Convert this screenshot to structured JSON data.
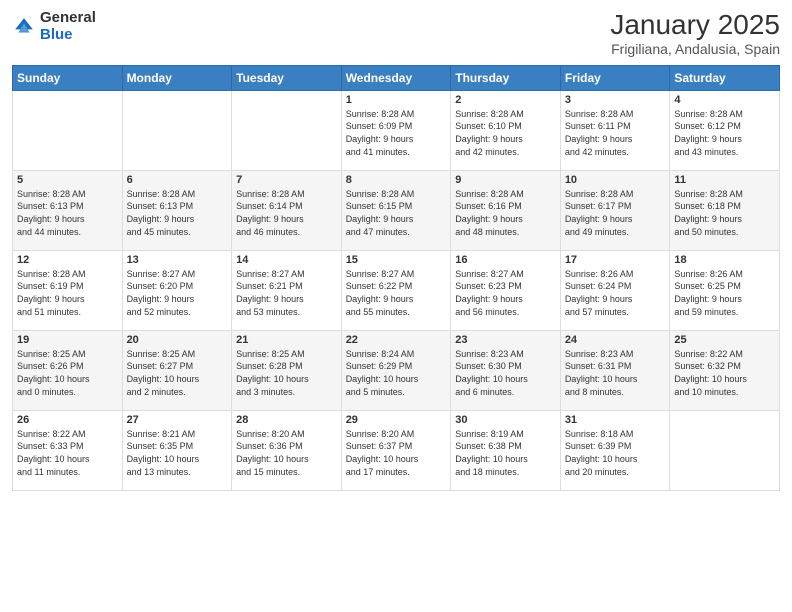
{
  "logo": {
    "general": "General",
    "blue": "Blue"
  },
  "header": {
    "title": "January 2025",
    "subtitle": "Frigiliana, Andalusia, Spain"
  },
  "weekdays": [
    "Sunday",
    "Monday",
    "Tuesday",
    "Wednesday",
    "Thursday",
    "Friday",
    "Saturday"
  ],
  "weeks": [
    [
      {
        "day": "",
        "info": ""
      },
      {
        "day": "",
        "info": ""
      },
      {
        "day": "",
        "info": ""
      },
      {
        "day": "1",
        "info": "Sunrise: 8:28 AM\nSunset: 6:09 PM\nDaylight: 9 hours\nand 41 minutes."
      },
      {
        "day": "2",
        "info": "Sunrise: 8:28 AM\nSunset: 6:10 PM\nDaylight: 9 hours\nand 42 minutes."
      },
      {
        "day": "3",
        "info": "Sunrise: 8:28 AM\nSunset: 6:11 PM\nDaylight: 9 hours\nand 42 minutes."
      },
      {
        "day": "4",
        "info": "Sunrise: 8:28 AM\nSunset: 6:12 PM\nDaylight: 9 hours\nand 43 minutes."
      }
    ],
    [
      {
        "day": "5",
        "info": "Sunrise: 8:28 AM\nSunset: 6:13 PM\nDaylight: 9 hours\nand 44 minutes."
      },
      {
        "day": "6",
        "info": "Sunrise: 8:28 AM\nSunset: 6:13 PM\nDaylight: 9 hours\nand 45 minutes."
      },
      {
        "day": "7",
        "info": "Sunrise: 8:28 AM\nSunset: 6:14 PM\nDaylight: 9 hours\nand 46 minutes."
      },
      {
        "day": "8",
        "info": "Sunrise: 8:28 AM\nSunset: 6:15 PM\nDaylight: 9 hours\nand 47 minutes."
      },
      {
        "day": "9",
        "info": "Sunrise: 8:28 AM\nSunset: 6:16 PM\nDaylight: 9 hours\nand 48 minutes."
      },
      {
        "day": "10",
        "info": "Sunrise: 8:28 AM\nSunset: 6:17 PM\nDaylight: 9 hours\nand 49 minutes."
      },
      {
        "day": "11",
        "info": "Sunrise: 8:28 AM\nSunset: 6:18 PM\nDaylight: 9 hours\nand 50 minutes."
      }
    ],
    [
      {
        "day": "12",
        "info": "Sunrise: 8:28 AM\nSunset: 6:19 PM\nDaylight: 9 hours\nand 51 minutes."
      },
      {
        "day": "13",
        "info": "Sunrise: 8:27 AM\nSunset: 6:20 PM\nDaylight: 9 hours\nand 52 minutes."
      },
      {
        "day": "14",
        "info": "Sunrise: 8:27 AM\nSunset: 6:21 PM\nDaylight: 9 hours\nand 53 minutes."
      },
      {
        "day": "15",
        "info": "Sunrise: 8:27 AM\nSunset: 6:22 PM\nDaylight: 9 hours\nand 55 minutes."
      },
      {
        "day": "16",
        "info": "Sunrise: 8:27 AM\nSunset: 6:23 PM\nDaylight: 9 hours\nand 56 minutes."
      },
      {
        "day": "17",
        "info": "Sunrise: 8:26 AM\nSunset: 6:24 PM\nDaylight: 9 hours\nand 57 minutes."
      },
      {
        "day": "18",
        "info": "Sunrise: 8:26 AM\nSunset: 6:25 PM\nDaylight: 9 hours\nand 59 minutes."
      }
    ],
    [
      {
        "day": "19",
        "info": "Sunrise: 8:25 AM\nSunset: 6:26 PM\nDaylight: 10 hours\nand 0 minutes."
      },
      {
        "day": "20",
        "info": "Sunrise: 8:25 AM\nSunset: 6:27 PM\nDaylight: 10 hours\nand 2 minutes."
      },
      {
        "day": "21",
        "info": "Sunrise: 8:25 AM\nSunset: 6:28 PM\nDaylight: 10 hours\nand 3 minutes."
      },
      {
        "day": "22",
        "info": "Sunrise: 8:24 AM\nSunset: 6:29 PM\nDaylight: 10 hours\nand 5 minutes."
      },
      {
        "day": "23",
        "info": "Sunrise: 8:23 AM\nSunset: 6:30 PM\nDaylight: 10 hours\nand 6 minutes."
      },
      {
        "day": "24",
        "info": "Sunrise: 8:23 AM\nSunset: 6:31 PM\nDaylight: 10 hours\nand 8 minutes."
      },
      {
        "day": "25",
        "info": "Sunrise: 8:22 AM\nSunset: 6:32 PM\nDaylight: 10 hours\nand 10 minutes."
      }
    ],
    [
      {
        "day": "26",
        "info": "Sunrise: 8:22 AM\nSunset: 6:33 PM\nDaylight: 10 hours\nand 11 minutes."
      },
      {
        "day": "27",
        "info": "Sunrise: 8:21 AM\nSunset: 6:35 PM\nDaylight: 10 hours\nand 13 minutes."
      },
      {
        "day": "28",
        "info": "Sunrise: 8:20 AM\nSunset: 6:36 PM\nDaylight: 10 hours\nand 15 minutes."
      },
      {
        "day": "29",
        "info": "Sunrise: 8:20 AM\nSunset: 6:37 PM\nDaylight: 10 hours\nand 17 minutes."
      },
      {
        "day": "30",
        "info": "Sunrise: 8:19 AM\nSunset: 6:38 PM\nDaylight: 10 hours\nand 18 minutes."
      },
      {
        "day": "31",
        "info": "Sunrise: 8:18 AM\nSunset: 6:39 PM\nDaylight: 10 hours\nand 20 minutes."
      },
      {
        "day": "",
        "info": ""
      }
    ]
  ]
}
